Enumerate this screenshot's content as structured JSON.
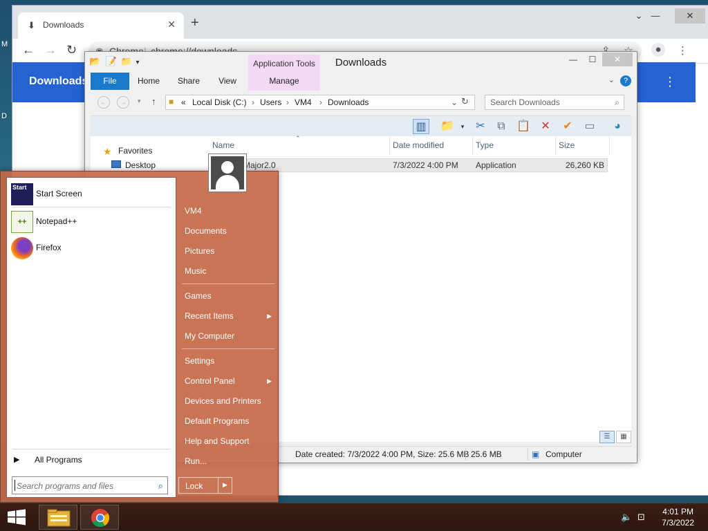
{
  "desktop": {
    "edge_letters": [
      "M",
      "D"
    ]
  },
  "chrome": {
    "tab_title": "Downloads",
    "tab_close": "✕",
    "new_tab": "+",
    "window_controls": {
      "minimize": "—",
      "maximize": "☐",
      "close": "✕"
    },
    "back": "←",
    "forward": "→",
    "reload": "↻",
    "url_chip": "Chrome",
    "url_separator": "|",
    "url": "chrome://downloads",
    "page_title": "Downloads",
    "menu": "⋮"
  },
  "explorer": {
    "title": "Downloads",
    "contextual_tab_group": "Application Tools",
    "ribbon_tabs": [
      "File",
      "Home",
      "Share",
      "View",
      "Manage"
    ],
    "help": "?",
    "address": {
      "prefix": "«",
      "segments": [
        "Local Disk (C:)",
        "Users",
        "VM4",
        "Downloads"
      ],
      "separator": "›"
    },
    "search_placeholder": "Search Downloads",
    "nav_pane": {
      "favorites": "Favorites",
      "desktop": "Desktop"
    },
    "columns": [
      "Name",
      "Date modified",
      "Type",
      "Size"
    ],
    "rows": [
      {
        "name": "Major2.0",
        "date_modified": "7/3/2022 4:00 PM",
        "type": "Application",
        "size": "26,260 KB"
      }
    ],
    "status": {
      "details": "Date created: 7/3/2022 4:00 PM, Size: 25.6 MB",
      "size": "25.6 MB",
      "location": "Computer"
    },
    "accent": "#1979ca",
    "ribbon_context_color": "#f3d9f3"
  },
  "start_menu": {
    "pinned": [
      {
        "label": "Start Screen",
        "icon": "start-screen-icon",
        "icon_text": "Start"
      },
      {
        "label": "Notepad++",
        "icon": "notepadpp-icon"
      },
      {
        "label": "Firefox",
        "icon": "firefox-icon"
      }
    ],
    "all_programs": "All Programs",
    "search_placeholder": "Search programs and files",
    "right_items": [
      "VM4",
      "Documents",
      "Pictures",
      "Music",
      "Games",
      "Recent Items",
      "My Computer",
      "Settings",
      "Control Panel",
      "Devices and Printers",
      "Default Programs",
      "Help and Support",
      "Run..."
    ],
    "lock": "Lock",
    "color": "#c46846"
  },
  "taskbar": {
    "items": [
      "start-button",
      "file-explorer-icon",
      "chrome-icon"
    ],
    "clock": {
      "time": "4:01 PM",
      "date": "7/3/2022"
    }
  }
}
